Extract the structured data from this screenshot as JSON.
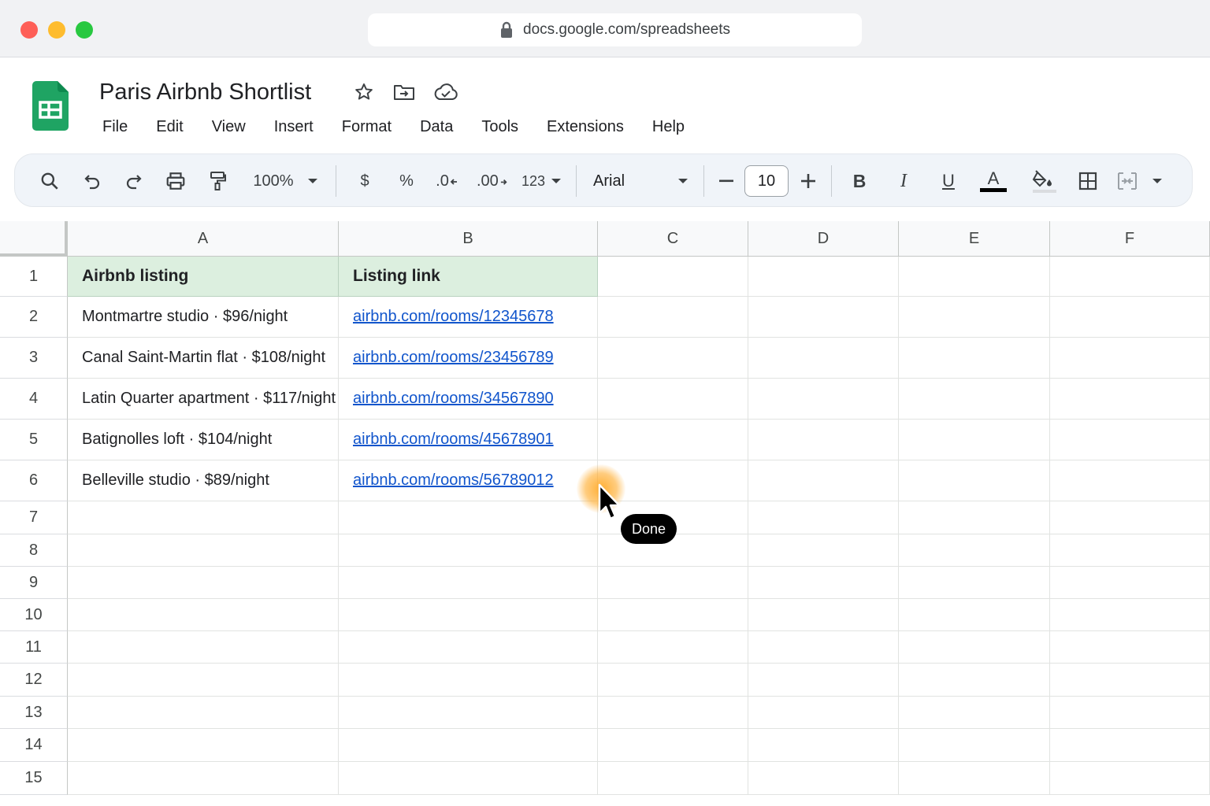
{
  "browser": {
    "url": "docs.google.com/spreadsheets"
  },
  "app": {
    "title": "Paris Airbnb Shortlist",
    "menu": [
      "File",
      "Edit",
      "View",
      "Insert",
      "Format",
      "Data",
      "Tools",
      "Extensions",
      "Help"
    ]
  },
  "toolbar": {
    "zoom": "100%",
    "currency": "$",
    "percent": "%",
    "decrease_decimal": ".0",
    "increase_decimal": ".00",
    "number_format": "123",
    "font": "Arial",
    "font_size": "10",
    "bold": "B",
    "italic": "I",
    "underline": "U",
    "text_color": "A",
    "text_color_value": "#000000"
  },
  "sheet": {
    "columns": [
      "A",
      "B",
      "C",
      "D",
      "E",
      "F"
    ],
    "rows": [
      "1",
      "2",
      "3",
      "4",
      "5",
      "6",
      "7",
      "8",
      "9",
      "10",
      "11",
      "12",
      "13",
      "14",
      "15"
    ],
    "header": [
      "Airbnb listing",
      "Listing link"
    ],
    "data": [
      [
        "Montmartre studio · $96/night",
        "airbnb.com/rooms/12345678"
      ],
      [
        "Canal Saint-Martin flat · $108/night",
        "airbnb.com/rooms/23456789"
      ],
      [
        "Latin Quarter apartment · $117/night",
        "airbnb.com/rooms/34567890"
      ],
      [
        "Batignolles loft · $104/night",
        "airbnb.com/rooms/45678901"
      ],
      [
        "Belleville studio · $89/night",
        "airbnb.com/rooms/56789012"
      ]
    ],
    "header_fill": "#dcefdf",
    "link_color": "#1155cc"
  },
  "tooltip": {
    "label": "Done"
  }
}
